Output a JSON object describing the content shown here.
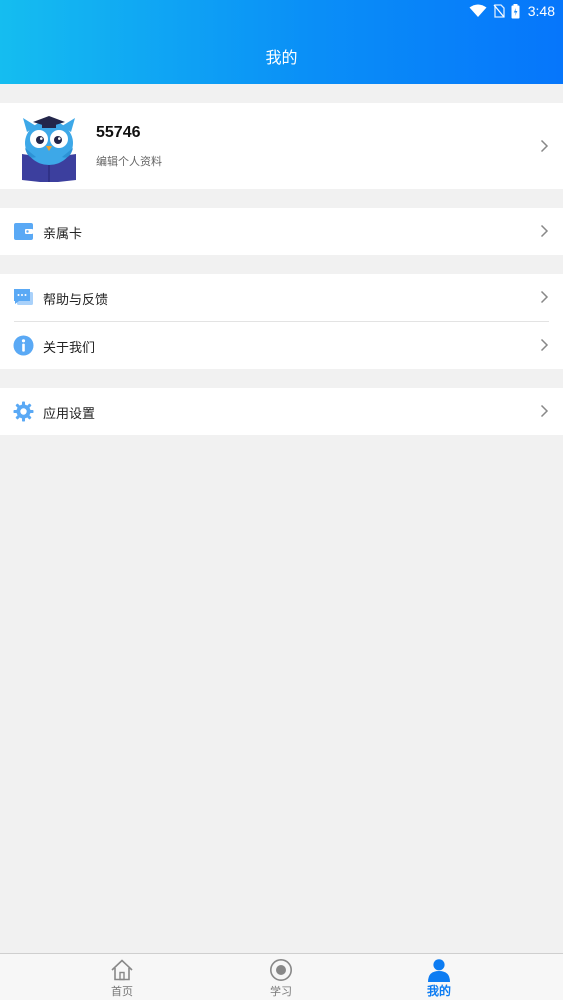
{
  "status_bar": {
    "time": "3:48"
  },
  "header": {
    "title": "我的"
  },
  "profile": {
    "username": "55746",
    "edit_label": "编辑个人资料"
  },
  "menu": {
    "family_card": {
      "label": "亲属卡",
      "icon": "wallet-icon"
    },
    "help": {
      "label": "帮助与反馈",
      "icon": "chat-icon"
    },
    "about": {
      "label": "关于我们",
      "icon": "info-icon"
    },
    "settings": {
      "label": "应用设置",
      "icon": "gear-icon"
    }
  },
  "tabbar": {
    "tabs": [
      {
        "label": "首页",
        "icon": "home-icon",
        "active": false
      },
      {
        "label": "学习",
        "icon": "record-icon",
        "active": false
      },
      {
        "label": "我的",
        "icon": "person-icon",
        "active": true
      }
    ]
  },
  "colors": {
    "accent": "#0d7cf2",
    "icon_blue": "#5aa9f5",
    "header_start": "#15bdf0",
    "header_end": "#0676fb"
  }
}
